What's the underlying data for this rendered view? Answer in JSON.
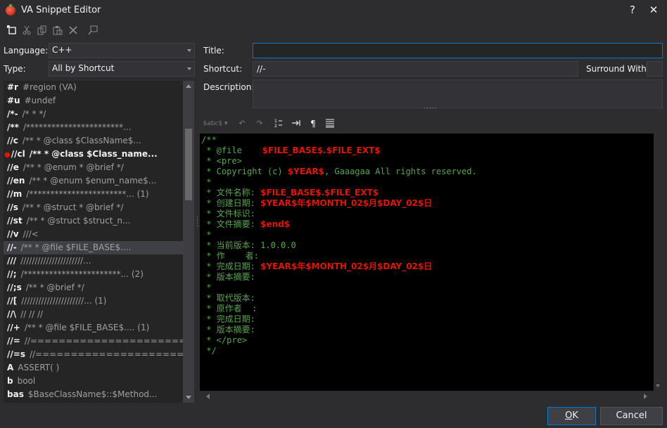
{
  "window": {
    "title": "VA Snippet Editor",
    "help_glyph": "?",
    "close_glyph": "✕"
  },
  "toolbar": {
    "icons": [
      "new-snippet-icon",
      "cut-icon",
      "copy-icon",
      "paste-icon",
      "delete-icon",
      "find-icon"
    ]
  },
  "filters": {
    "language_label": "Language:",
    "language_value": "C++",
    "type_label": "Type:",
    "type_value": "All by Shortcut"
  },
  "snippets": [
    {
      "shortcut": "#r",
      "title": "#region (VA)"
    },
    {
      "shortcut": "#u",
      "title": "#undef"
    },
    {
      "shortcut": "/*-",
      "title": "/* *   */"
    },
    {
      "shortcut": "/**",
      "title": "/***********************..."
    },
    {
      "shortcut": "//c",
      "title": "/** * @class $ClassName$..."
    },
    {
      "shortcut": "//cl",
      "title": "/** * @class $Class_name...",
      "modified": true
    },
    {
      "shortcut": "//e",
      "title": "/** * @enum   * @brief */"
    },
    {
      "shortcut": "//en",
      "title": "/** * @enum  $enum_name$..."
    },
    {
      "shortcut": "//m",
      "title": "/***********************... (1)"
    },
    {
      "shortcut": "//s",
      "title": "/** * @struct   * @brief */"
    },
    {
      "shortcut": "//st",
      "title": "/** * @struct  $struct_n..."
    },
    {
      "shortcut": "//v",
      "title": "///<"
    },
    {
      "shortcut": "//-",
      "title": "/** * @file $FILE_BASE$....",
      "selected": true
    },
    {
      "shortcut": "///",
      "title": "//////////////////////..."
    },
    {
      "shortcut": "//;",
      "title": "/***********************... (2)"
    },
    {
      "shortcut": "//;s",
      "title": "/** * @brief   */"
    },
    {
      "shortcut": "//[",
      "title": "//////////////////////... (1)"
    },
    {
      "shortcut": "//\\",
      "title": "// //   //"
    },
    {
      "shortcut": "//+",
      "title": "/** * @file $FILE_BASE$.... (1)"
    },
    {
      "shortcut": "//=",
      "title": "//======================..."
    },
    {
      "shortcut": "//=s",
      "title": "//======================..."
    },
    {
      "shortcut": "A",
      "title": "ASSERT( )"
    },
    {
      "shortcut": "b",
      "title": "bool"
    },
    {
      "shortcut": "bas",
      "title": "$BaseClassName$::$Method..."
    }
  ],
  "form": {
    "title_label": "Title:",
    "title_value": "",
    "shortcut_label": "Shortcut:",
    "shortcut_value": "//-",
    "surround_label": "Surround With",
    "description_label": "Description:",
    "description_value": ""
  },
  "editor_toolbar": {
    "insert_label": "$abc$",
    "icons": [
      "insert-variable-icon",
      "undo-icon",
      "redo-icon",
      "line-numbers-icon",
      "tab-icon",
      "paragraph-icon",
      "wrap-icon"
    ]
  },
  "code": [
    [
      {
        "t": "/**"
      }
    ],
    [
      {
        "t": " * @file    "
      },
      {
        "v": "$FILE_BASE$.$FILE_EXT$"
      }
    ],
    [
      {
        "t": " * <pre>"
      }
    ],
    [
      {
        "t": " * Copyright (c) "
      },
      {
        "v": "$YEAR$"
      },
      {
        "t": ", Gaaagaa All rights reserved."
      }
    ],
    [
      {
        "t": " *"
      }
    ],
    [
      {
        "t": " * 文件名称: "
      },
      {
        "v": "$FILE_BASE$.$FILE_EXT$"
      }
    ],
    [
      {
        "t": " * 创建日期: "
      },
      {
        "v": "$YEAR$年$MONTH_02$月$DAY_02$日"
      }
    ],
    [
      {
        "t": " * 文件标识:"
      }
    ],
    [
      {
        "t": " * 文件摘要: "
      },
      {
        "v": "$end$"
      }
    ],
    [
      {
        "t": " *"
      }
    ],
    [
      {
        "t": " * 当前版本: 1.0.0.0"
      }
    ],
    [
      {
        "t": " * 作    者:"
      }
    ],
    [
      {
        "t": " * 完成日期: "
      },
      {
        "v": "$YEAR$年$MONTH_02$月$DAY_02$日"
      }
    ],
    [
      {
        "t": " * 版本摘要:"
      }
    ],
    [
      {
        "t": " *"
      }
    ],
    [
      {
        "t": " * 取代版本:"
      }
    ],
    [
      {
        "t": " * 原作者  :"
      }
    ],
    [
      {
        "t": " * 完成日期:"
      }
    ],
    [
      {
        "t": " * 版本摘要:"
      }
    ],
    [
      {
        "t": " * </pre>"
      }
    ],
    [
      {
        "t": " */"
      }
    ]
  ],
  "colors": {
    "background": "#2d2d30",
    "editor_bg": "#000000",
    "comment_green": "#57a64a",
    "variable_red": "#e51400",
    "focus_blue": "#007acc"
  },
  "buttons": {
    "ok": "OK",
    "cancel": "Cancel"
  }
}
